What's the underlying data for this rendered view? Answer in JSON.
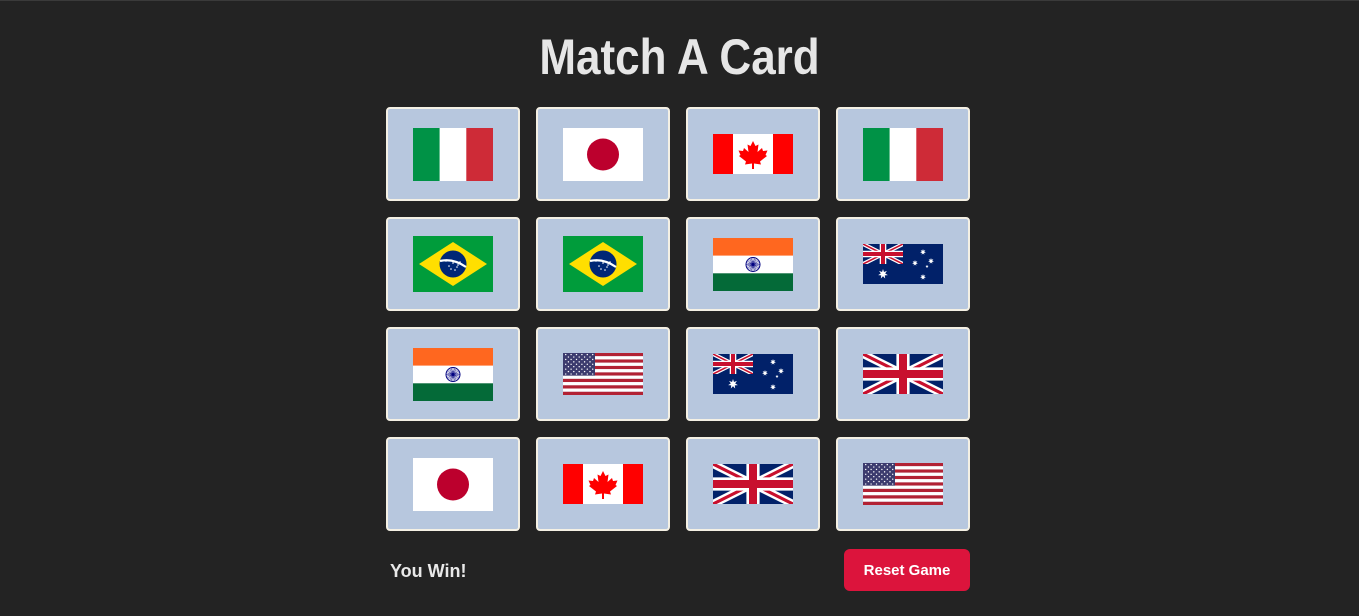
{
  "title": "Match A Card",
  "status_text": "You Win!",
  "reset_label": "Reset Game",
  "colors": {
    "background": "#232323",
    "card": "#b7c7de",
    "card_border": "#f4f0e4",
    "reset_button": "#dc143c"
  },
  "cards": [
    {
      "flag": "italy"
    },
    {
      "flag": "japan"
    },
    {
      "flag": "canada"
    },
    {
      "flag": "italy"
    },
    {
      "flag": "brazil"
    },
    {
      "flag": "brazil"
    },
    {
      "flag": "india"
    },
    {
      "flag": "australia"
    },
    {
      "flag": "india"
    },
    {
      "flag": "usa"
    },
    {
      "flag": "australia"
    },
    {
      "flag": "uk"
    },
    {
      "flag": "japan"
    },
    {
      "flag": "canada"
    },
    {
      "flag": "uk"
    },
    {
      "flag": "usa"
    }
  ]
}
